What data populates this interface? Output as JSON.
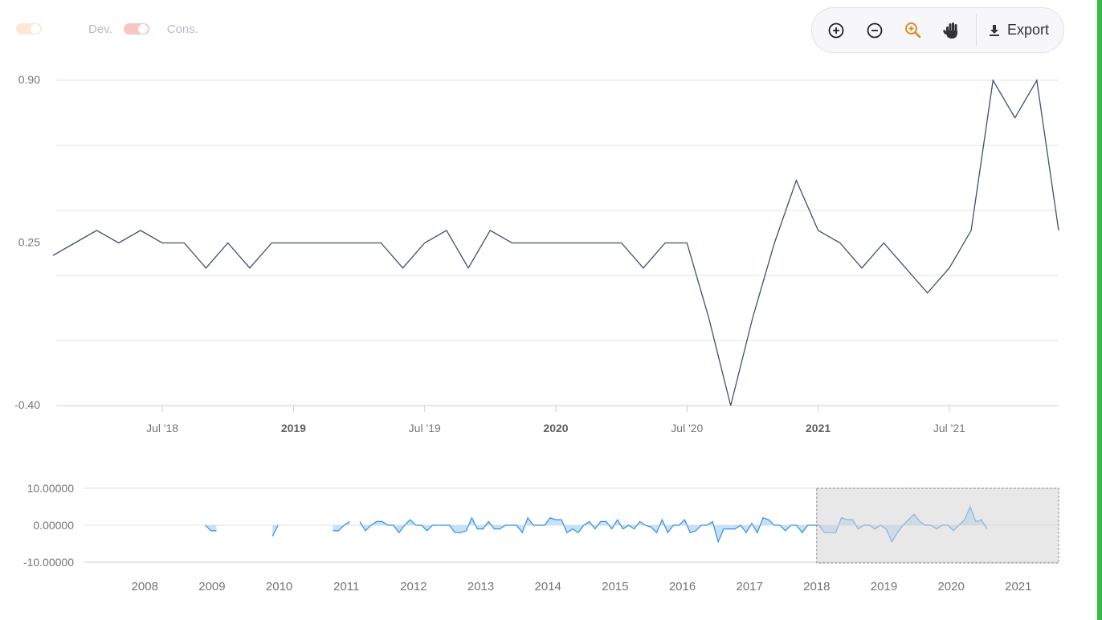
{
  "legend": [
    {
      "label": "",
      "color": "#fde8d8"
    },
    {
      "label": "Dev.",
      "color": "#f6c6c2"
    },
    {
      "label": "Cons.",
      "color": ""
    }
  ],
  "toolbar": {
    "zoom_in_icon": "plus-circle-icon",
    "zoom_out_icon": "minus-circle-icon",
    "zoom_select_icon": "magnifier-plus-icon",
    "pan_icon": "hand-icon",
    "export_icon": "download-icon",
    "export_label": "Export",
    "active_color": "#e08a1e"
  },
  "chart_data": [
    {
      "type": "line",
      "x_start": "2018-02",
      "x_step": "month",
      "values": [
        0.2,
        0.25,
        0.3,
        0.25,
        0.3,
        0.25,
        0.25,
        0.15,
        0.25,
        0.15,
        0.25,
        0.25,
        0.25,
        0.25,
        0.25,
        0.25,
        0.15,
        0.25,
        0.3,
        0.15,
        0.3,
        0.25,
        0.25,
        0.25,
        0.25,
        0.25,
        0.25,
        0.15,
        0.25,
        0.25,
        -0.05,
        -0.4,
        -0.05,
        0.25,
        0.5,
        0.3,
        0.25,
        0.15,
        0.25,
        0.15,
        0.05,
        0.15,
        0.3,
        0.9,
        0.75,
        0.9,
        0.3
      ],
      "y_ticks": [
        "0.90",
        "0.25",
        "-0.40"
      ],
      "ylim": [
        -0.4,
        0.9
      ],
      "x_ticks": [
        {
          "label": "Jul '18",
          "date": "2018-07",
          "major": false
        },
        {
          "label": "2019",
          "date": "2019-01",
          "major": true
        },
        {
          "label": "Jul '19",
          "date": "2019-07",
          "major": false
        },
        {
          "label": "2020",
          "date": "2020-01",
          "major": true
        },
        {
          "label": "Jul '20",
          "date": "2020-07",
          "major": false
        },
        {
          "label": "2021",
          "date": "2021-01",
          "major": true
        },
        {
          "label": "Jul '21",
          "date": "2021-07",
          "major": false
        }
      ],
      "grid": true,
      "line_color": "#3d5170"
    },
    {
      "type": "area",
      "role": "navigator",
      "y_ticks": [
        "10.00000",
        "0.00000",
        "-10.00000"
      ],
      "ylim": [
        -10,
        10
      ],
      "x_ticks": [
        "2008",
        "2009",
        "2010",
        "2011",
        "2012",
        "2013",
        "2014",
        "2015",
        "2016",
        "2017",
        "2018",
        "2019",
        "2020",
        "2021"
      ],
      "x_range": [
        2007.1,
        2021.6
      ],
      "selection": [
        2018.0,
        2021.6
      ],
      "series_color": "#2f8ee5",
      "fill_color": "#bcdcf7",
      "segments": [
        {
          "start": 2008.9,
          "values": [
            0,
            -1.5,
            -1.5
          ]
        },
        {
          "start": 2009.9,
          "values": [
            -3,
            0
          ]
        },
        {
          "start": 2010.8,
          "values": [
            -1.5,
            -1.5,
            0,
            1
          ]
        },
        {
          "start": 2011.2,
          "values": [
            1,
            -1.5,
            0,
            1,
            1,
            0,
            0,
            -2,
            0,
            1.5,
            0,
            0,
            -1.5,
            0,
            0,
            0,
            0,
            -2,
            -2,
            -1.5,
            2,
            -1,
            -1,
            1,
            -1,
            -1,
            0,
            0,
            0,
            -2,
            2,
            0,
            0,
            0,
            2,
            1.5,
            1.5,
            -2,
            -1,
            -2,
            0,
            1,
            -1,
            1,
            1,
            -1,
            1.5,
            -1,
            0,
            -1,
            1,
            0,
            -0.5,
            -2,
            1.5,
            -2,
            0,
            0,
            1.5,
            -2,
            -1.5,
            0,
            0,
            1,
            -4.5,
            -1,
            -1,
            -1,
            0,
            -2,
            0.5,
            -2,
            2,
            1.5,
            0,
            0,
            -1.5,
            0,
            0,
            -2,
            0,
            0,
            0,
            -2,
            -2,
            -2,
            2,
            1.5,
            1.5,
            -1,
            0,
            0,
            -1,
            0,
            -1,
            -4.5,
            -2,
            0,
            1.5,
            3,
            1,
            0,
            0,
            -1,
            0,
            0,
            -1.5,
            0,
            1.5,
            5,
            1,
            1.5,
            -1
          ]
        }
      ]
    }
  ]
}
